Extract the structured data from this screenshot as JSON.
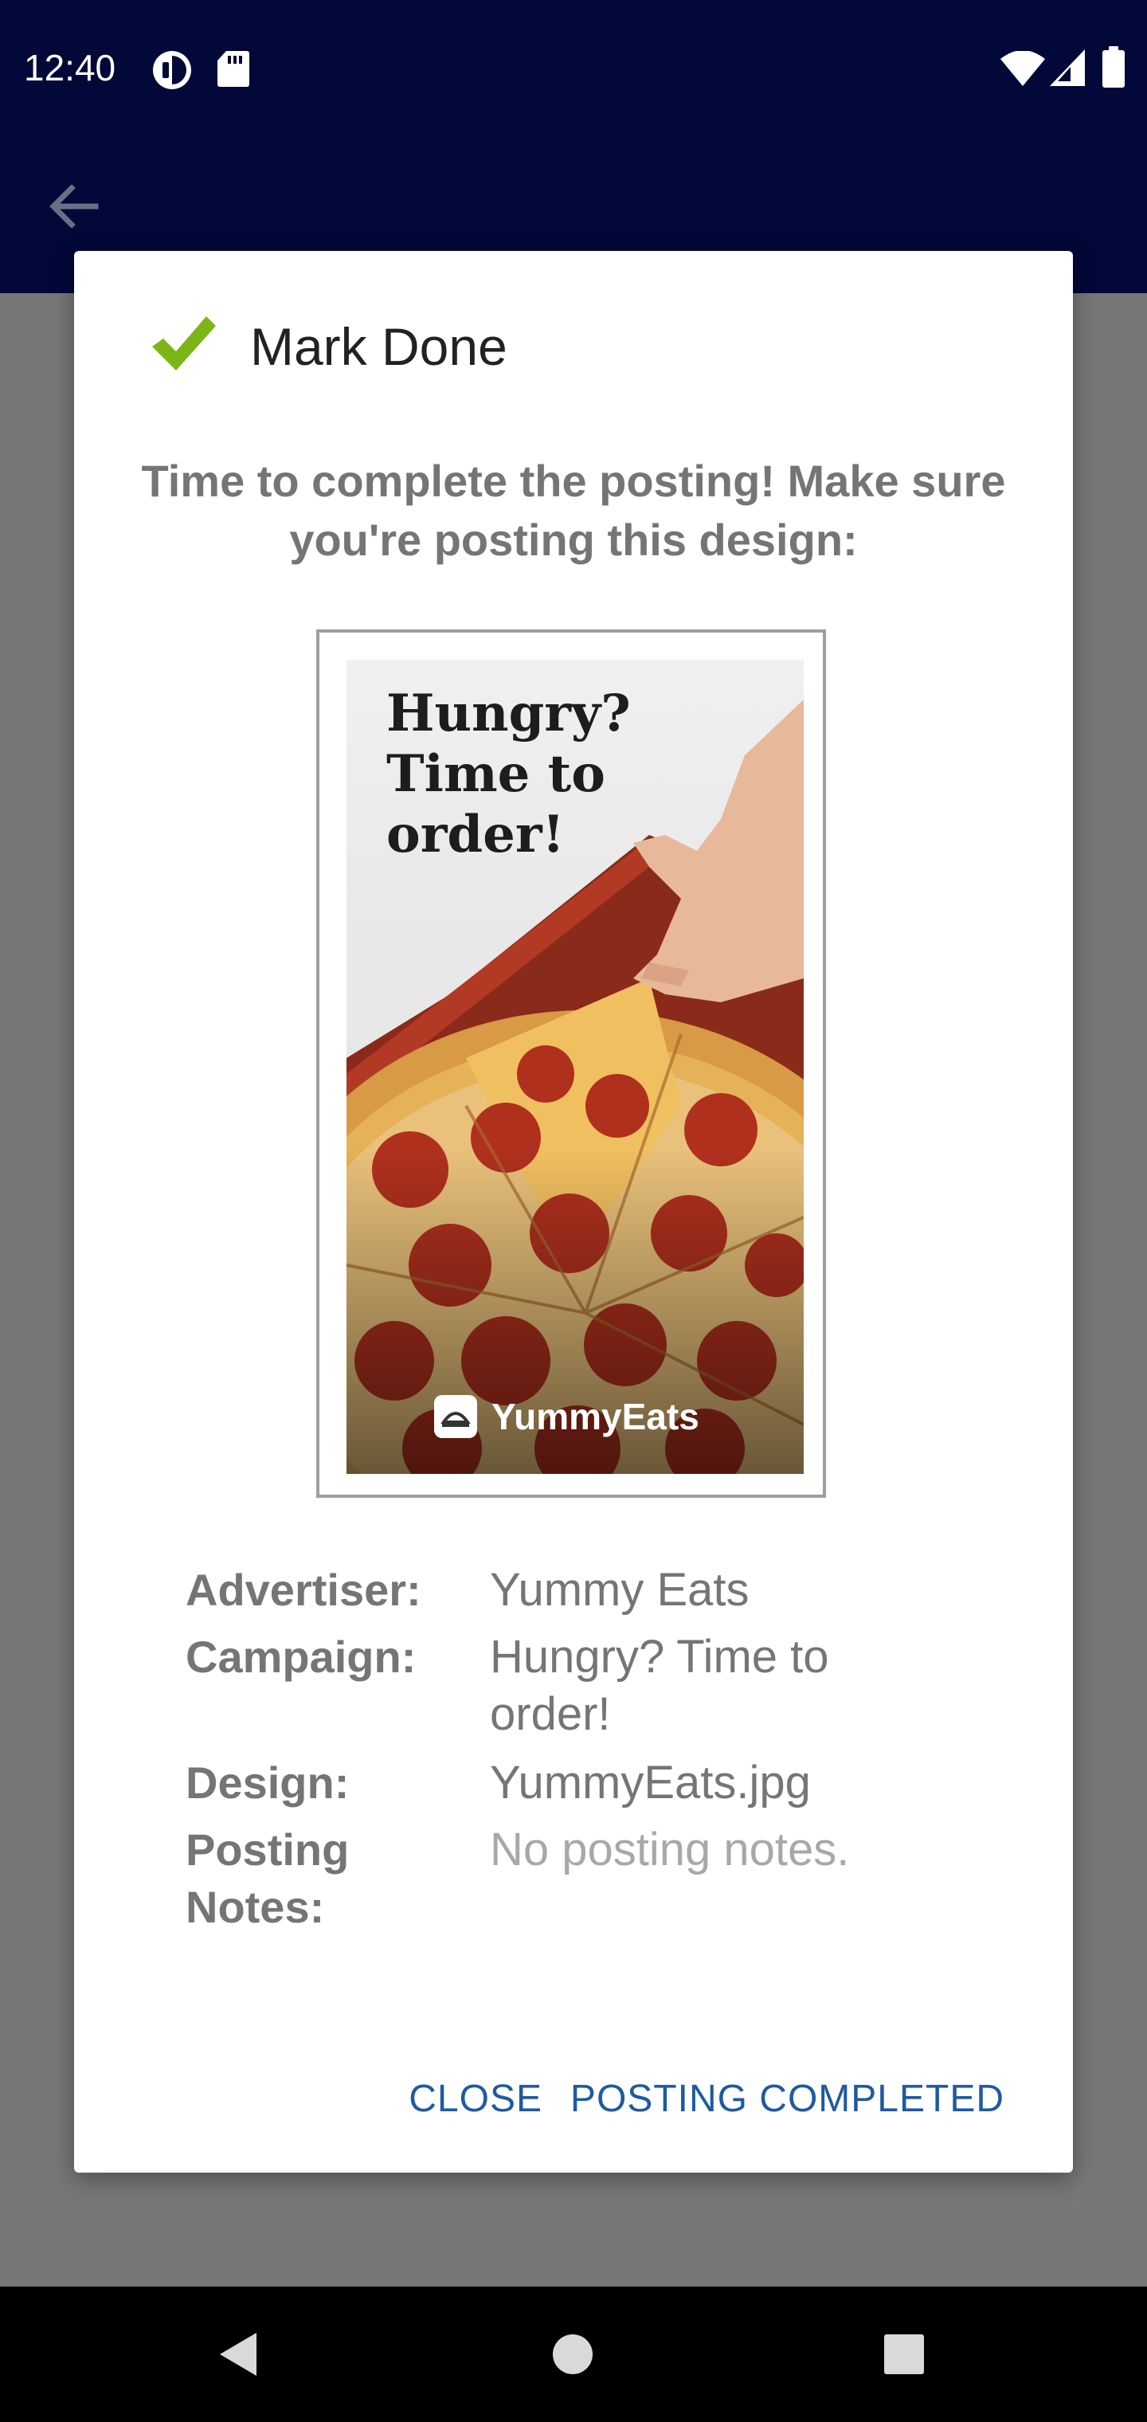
{
  "status_bar": {
    "time": "12:40",
    "left_icons": [
      "speed-icon",
      "sd-card-icon"
    ],
    "right_icons": [
      "wifi-icon",
      "cell-signal-icon",
      "battery-icon"
    ]
  },
  "app_bar": {
    "back_icon": "arrow-back-icon",
    "color": "#020838"
  },
  "dialog": {
    "title": "Mark Done",
    "title_icon": "checkmark-icon",
    "check_color": "#7cb518",
    "message": "Time to complete the posting! Make sure you're posting this design:",
    "design_image": {
      "headline": "Hungry? Time to order!",
      "brand": "YummyEats"
    },
    "details": {
      "advertiser_label": "Advertiser:",
      "advertiser_value": "Yummy Eats",
      "campaign_label": "Campaign:",
      "campaign_value": "Hungry? Time to order!",
      "design_label": "Design:",
      "design_value": "YummyEats.jpg",
      "notes_label": "Posting Notes:",
      "notes_value": "No posting notes."
    },
    "actions": {
      "close": "CLOSE",
      "posting_completed": "POSTING COMPLETED"
    },
    "action_color": "#1e5aa0"
  },
  "nav_bar": {
    "back_icon": "nav-back-icon",
    "home_icon": "nav-home-icon",
    "recents_icon": "nav-recents-icon"
  }
}
